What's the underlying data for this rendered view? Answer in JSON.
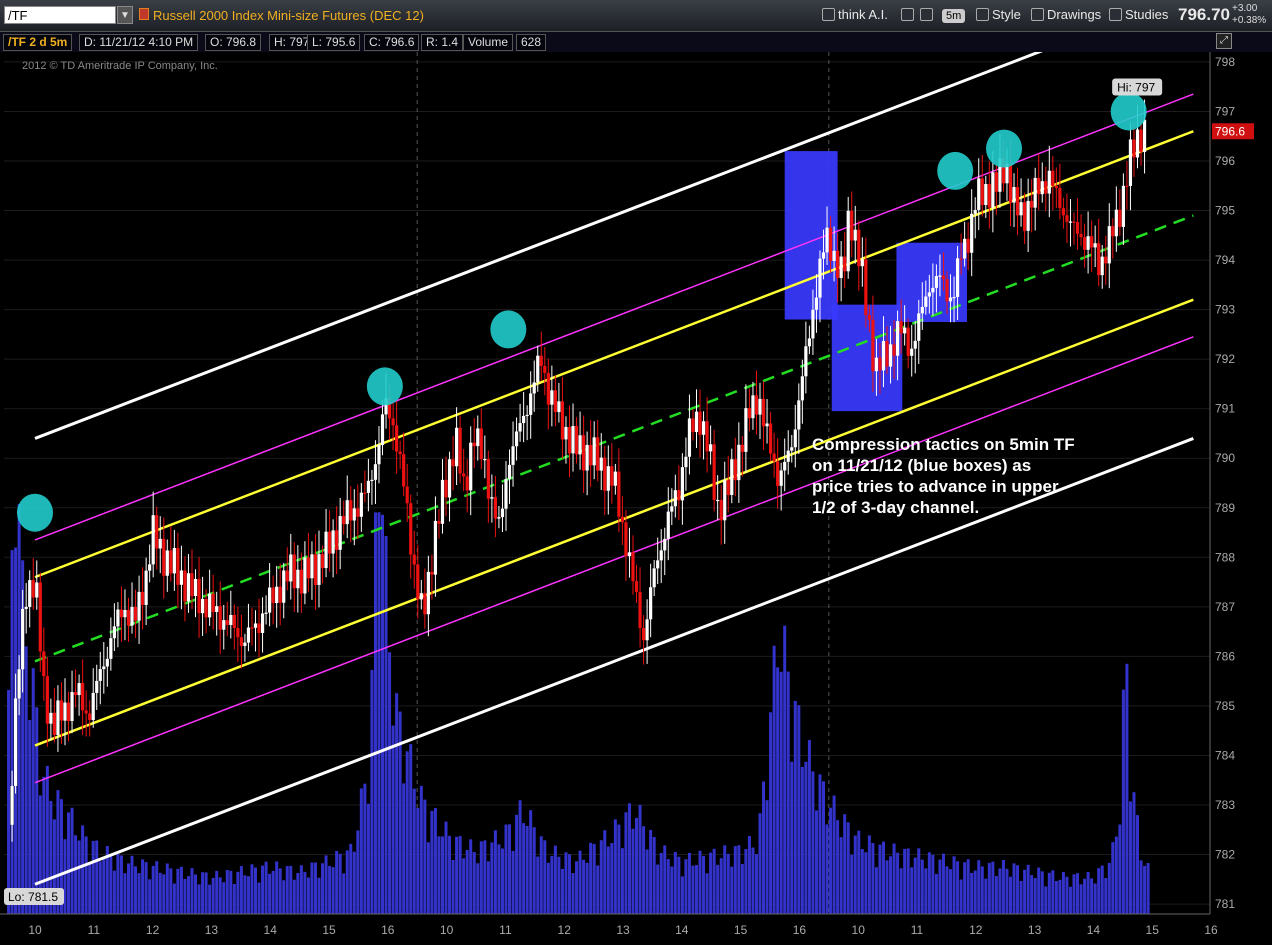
{
  "toolbar": {
    "symbol": "/TF",
    "dropdown_glyph": "▼",
    "instrument": "Russell 2000 Index Mini-size Futures (DEC 12)",
    "think_ai": "think A.I.",
    "timeframe": "5m",
    "style": "Style",
    "drawings": "Drawings",
    "studies": "Studies",
    "last_price": "796.70",
    "change": "+3.00",
    "change_pct": "+0.38%"
  },
  "infobar": {
    "label": "/TF 2 d 5m",
    "date": "D: 11/21/12 4:10 PM",
    "open": "O: 796.8",
    "high": "H: 797",
    "low": "L: 795.6",
    "close": "C: 796.6",
    "range": "R: 1.4",
    "volume_label": "Volume",
    "volume": "628"
  },
  "copyright": "2012 © TD Ameritrade IP Company, Inc.",
  "chart_data": {
    "type": "candlestick",
    "ylim": [
      780.8,
      798.2
    ],
    "yticks": [
      781,
      782,
      783,
      784,
      785,
      786,
      787,
      788,
      789,
      790,
      791,
      792,
      793,
      794,
      795,
      796,
      797,
      798
    ],
    "x_tick_labels": [
      "10",
      "11",
      "12",
      "13",
      "14",
      "15",
      "16",
      "10",
      "11",
      "12",
      "13",
      "14",
      "15",
      "16",
      "10",
      "11",
      "12",
      "13",
      "14",
      "15",
      "16"
    ],
    "hi_label": "Hi: 797",
    "lo_label": "Lo: 781.5",
    "price_label": "796.6",
    "annotation": "Compression tactics on 5min TF on 11/21/12 (blue boxes) as price tries to advance in upper 1/2 of 3-day channel.",
    "day_separators": [
      6.5,
      13.5
    ],
    "channel": {
      "start_x": 0,
      "end_x": 19.7,
      "mid_start": 785.9,
      "mid_end": 794.9,
      "offsets": [
        {
          "offset": 4.5,
          "color": "#ffffff"
        },
        {
          "offset": 2.45,
          "color": "#ff33ff"
        },
        {
          "offset": 1.7,
          "color": "#ffff33"
        },
        {
          "offset": -1.7,
          "color": "#ffff33"
        },
        {
          "offset": -2.45,
          "color": "#ff33ff"
        },
        {
          "offset": -4.5,
          "color": "#ffffff"
        }
      ],
      "mid_color": "#22dd22"
    },
    "boxes": [
      {
        "x0": 12.75,
        "x1": 13.65,
        "y0": 792.8,
        "y1": 796.2
      },
      {
        "x0": 13.55,
        "x1": 14.75,
        "y0": 790.95,
        "y1": 793.1
      },
      {
        "x0": 14.65,
        "x1": 15.85,
        "y0": 792.75,
        "y1": 794.35
      }
    ],
    "markers": [
      {
        "x": 0.0,
        "y": 788.9
      },
      {
        "x": 5.95,
        "y": 791.45
      },
      {
        "x": 8.05,
        "y": 792.6
      },
      {
        "x": 15.65,
        "y": 795.8
      },
      {
        "x": 16.48,
        "y": 796.25
      },
      {
        "x": 18.6,
        "y": 797.0
      }
    ],
    "price_path": [
      [
        -0.45,
        782.6
      ],
      [
        -0.3,
        785.5
      ],
      [
        -0.15,
        787.3
      ],
      [
        0.0,
        787.6
      ],
      [
        0.15,
        785.3
      ],
      [
        0.3,
        784.6
      ],
      [
        0.5,
        784.9
      ],
      [
        0.7,
        785.3
      ],
      [
        0.9,
        784.8
      ],
      [
        1.1,
        785.6
      ],
      [
        1.3,
        786.4
      ],
      [
        1.5,
        787.0
      ],
      [
        1.7,
        786.7
      ],
      [
        1.9,
        787.7
      ],
      [
        2.0,
        788.5
      ],
      [
        2.15,
        788.1
      ],
      [
        2.35,
        787.8
      ],
      [
        2.55,
        787.5
      ],
      [
        2.75,
        787.2
      ],
      [
        2.95,
        787.0
      ],
      [
        3.15,
        786.8
      ],
      [
        3.35,
        786.6
      ],
      [
        3.55,
        786.3
      ],
      [
        3.75,
        786.6
      ],
      [
        3.95,
        787.0
      ],
      [
        4.15,
        787.4
      ],
      [
        4.35,
        787.7
      ],
      [
        4.55,
        787.6
      ],
      [
        4.75,
        787.8
      ],
      [
        5.0,
        788.2
      ],
      [
        5.2,
        788.7
      ],
      [
        5.45,
        789.0
      ],
      [
        5.65,
        789.3
      ],
      [
        5.85,
        790.3
      ],
      [
        5.95,
        791.1
      ],
      [
        6.1,
        790.7
      ],
      [
        6.25,
        789.6
      ],
      [
        6.45,
        787.8
      ],
      [
        6.6,
        786.7
      ],
      [
        6.8,
        788.5
      ],
      [
        7.0,
        789.5
      ],
      [
        7.15,
        790.5
      ],
      [
        7.3,
        789.2
      ],
      [
        7.45,
        790.6
      ],
      [
        7.65,
        789.8
      ],
      [
        7.9,
        788.5
      ],
      [
        8.05,
        790.0
      ],
      [
        8.25,
        790.6
      ],
      [
        8.45,
        791.4
      ],
      [
        8.6,
        792.0
      ],
      [
        8.75,
        791.3
      ],
      [
        8.95,
        790.7
      ],
      [
        9.2,
        790.2
      ],
      [
        9.45,
        790.1
      ],
      [
        9.65,
        789.8
      ],
      [
        9.85,
        789.5
      ],
      [
        10.05,
        788.3
      ],
      [
        10.2,
        787.3
      ],
      [
        10.35,
        786.4
      ],
      [
        10.55,
        787.8
      ],
      [
        10.75,
        788.7
      ],
      [
        10.95,
        789.4
      ],
      [
        11.1,
        790.4
      ],
      [
        11.3,
        790.9
      ],
      [
        11.45,
        790.2
      ],
      [
        11.6,
        789.0
      ],
      [
        11.8,
        789.4
      ],
      [
        12.0,
        790.3
      ],
      [
        12.15,
        790.9
      ],
      [
        12.3,
        791.3
      ],
      [
        12.45,
        790.4
      ],
      [
        12.65,
        789.6
      ],
      [
        12.85,
        790.1
      ],
      [
        13.0,
        791.3
      ],
      [
        13.15,
        792.3
      ],
      [
        13.3,
        793.6
      ],
      [
        13.45,
        794.4
      ],
      [
        13.6,
        794.1
      ],
      [
        13.75,
        793.6
      ],
      [
        13.85,
        795.0
      ],
      [
        14.0,
        794.2
      ],
      [
        14.15,
        792.9
      ],
      [
        14.3,
        791.8
      ],
      [
        14.5,
        792.1
      ],
      [
        14.7,
        792.6
      ],
      [
        14.9,
        792.2
      ],
      [
        15.05,
        792.8
      ],
      [
        15.2,
        793.5
      ],
      [
        15.4,
        793.6
      ],
      [
        15.6,
        793.2
      ],
      [
        15.75,
        794.1
      ],
      [
        15.9,
        794.6
      ],
      [
        16.0,
        795.2
      ],
      [
        16.15,
        795.4
      ],
      [
        16.35,
        795.5
      ],
      [
        16.5,
        796.0
      ],
      [
        16.65,
        795.1
      ],
      [
        16.8,
        794.9
      ],
      [
        16.95,
        795.2
      ],
      [
        17.1,
        795.5
      ],
      [
        17.25,
        795.7
      ],
      [
        17.35,
        795.3
      ],
      [
        17.5,
        795.0
      ],
      [
        17.65,
        794.6
      ],
      [
        17.8,
        794.5
      ],
      [
        17.95,
        794.3
      ],
      [
        18.1,
        793.9
      ],
      [
        18.25,
        794.3
      ],
      [
        18.4,
        794.8
      ],
      [
        18.5,
        795.3
      ],
      [
        18.6,
        795.9
      ],
      [
        18.7,
        796.3
      ],
      [
        18.8,
        796.6
      ],
      [
        18.9,
        796.6
      ]
    ],
    "volume_path": [
      [
        -0.45,
        0.4
      ],
      [
        -0.3,
        0.95
      ],
      [
        -0.2,
        0.55
      ],
      [
        -0.05,
        0.45
      ],
      [
        0.1,
        0.28
      ],
      [
        0.3,
        0.22
      ],
      [
        0.5,
        0.2
      ],
      [
        0.8,
        0.15
      ],
      [
        1.1,
        0.12
      ],
      [
        1.5,
        0.1
      ],
      [
        2.0,
        0.09
      ],
      [
        2.5,
        0.08
      ],
      [
        3.0,
        0.07
      ],
      [
        3.5,
        0.08
      ],
      [
        4.0,
        0.09
      ],
      [
        4.5,
        0.08
      ],
      [
        5.0,
        0.1
      ],
      [
        5.4,
        0.12
      ],
      [
        5.7,
        0.3
      ],
      [
        5.85,
        0.95
      ],
      [
        6.0,
        0.55
      ],
      [
        6.15,
        0.38
      ],
      [
        6.35,
        0.3
      ],
      [
        6.55,
        0.22
      ],
      [
        6.8,
        0.18
      ],
      [
        7.1,
        0.14
      ],
      [
        7.5,
        0.12
      ],
      [
        8.0,
        0.15
      ],
      [
        8.3,
        0.2
      ],
      [
        8.7,
        0.12
      ],
      [
        9.2,
        0.1
      ],
      [
        9.8,
        0.15
      ],
      [
        10.2,
        0.2
      ],
      [
        10.6,
        0.12
      ],
      [
        11.0,
        0.1
      ],
      [
        11.5,
        0.11
      ],
      [
        12.0,
        0.12
      ],
      [
        12.3,
        0.14
      ],
      [
        12.45,
        0.3
      ],
      [
        12.65,
        0.55
      ],
      [
        12.85,
        0.42
      ],
      [
        13.0,
        0.35
      ],
      [
        13.2,
        0.28
      ],
      [
        13.45,
        0.22
      ],
      [
        13.7,
        0.18
      ],
      [
        14.0,
        0.14
      ],
      [
        14.5,
        0.12
      ],
      [
        15.0,
        0.11
      ],
      [
        15.5,
        0.1
      ],
      [
        16.0,
        0.09
      ],
      [
        16.5,
        0.09
      ],
      [
        17.0,
        0.08
      ],
      [
        17.5,
        0.07
      ],
      [
        18.0,
        0.07
      ],
      [
        18.3,
        0.1
      ],
      [
        18.45,
        0.2
      ],
      [
        18.55,
        0.5
      ],
      [
        18.65,
        0.26
      ],
      [
        18.8,
        0.12
      ],
      [
        18.95,
        0.08
      ]
    ]
  }
}
